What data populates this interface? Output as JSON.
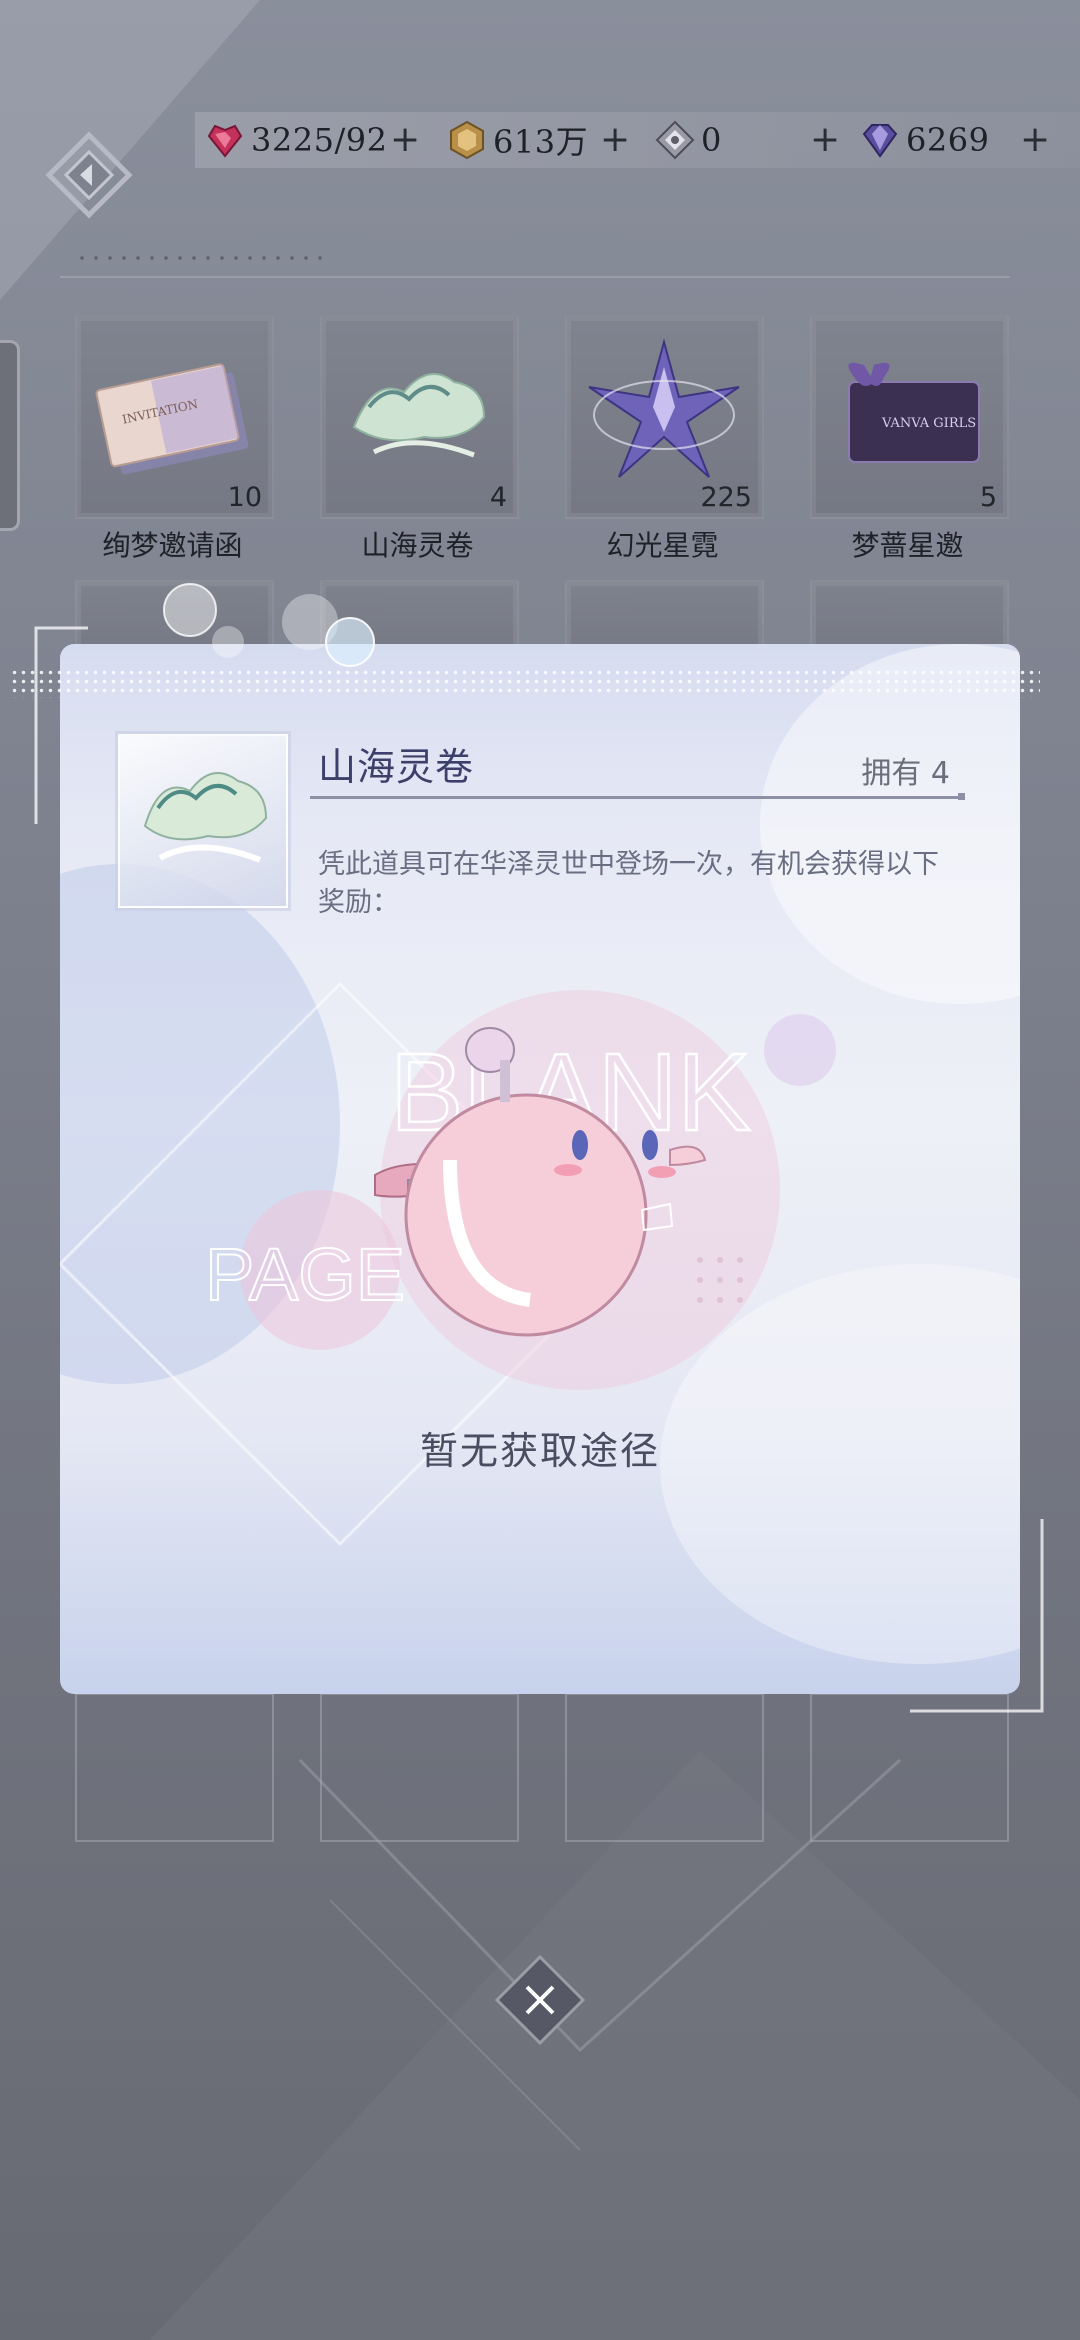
{
  "currencies": [
    {
      "name": "heart-gem-icon",
      "value": "3225/92"
    },
    {
      "name": "gold-coin-icon",
      "value": "613万"
    },
    {
      "name": "crystal-icon",
      "value": "0"
    },
    {
      "name": "diamond-icon",
      "value": "6269"
    }
  ],
  "plus_label": "+",
  "items": [
    {
      "name": "绚梦邀请函",
      "count": "10"
    },
    {
      "name": "山海灵卷",
      "count": "4"
    },
    {
      "name": "幻光星霓",
      "count": "225"
    },
    {
      "name": "梦蔷星邀",
      "count": "5"
    }
  ],
  "card_labels": {
    "invitation": "INVITATION",
    "vanva_girls": "VANVA GIRLS"
  },
  "detail": {
    "title": "山海灵卷",
    "owned": "拥有 4",
    "description": "凭此道具可在华泽灵世中登场一次，有机会获得以下奖励：",
    "empty_message": "暂无获取途径",
    "watermark_top": "BLANK",
    "watermark_left": "PAGE"
  },
  "close_label": "✕",
  "colors": {
    "modal_bg": "#e6e9f5",
    "title_text": "#3c3f6a",
    "mascot_pink": "#f4c8d8"
  }
}
